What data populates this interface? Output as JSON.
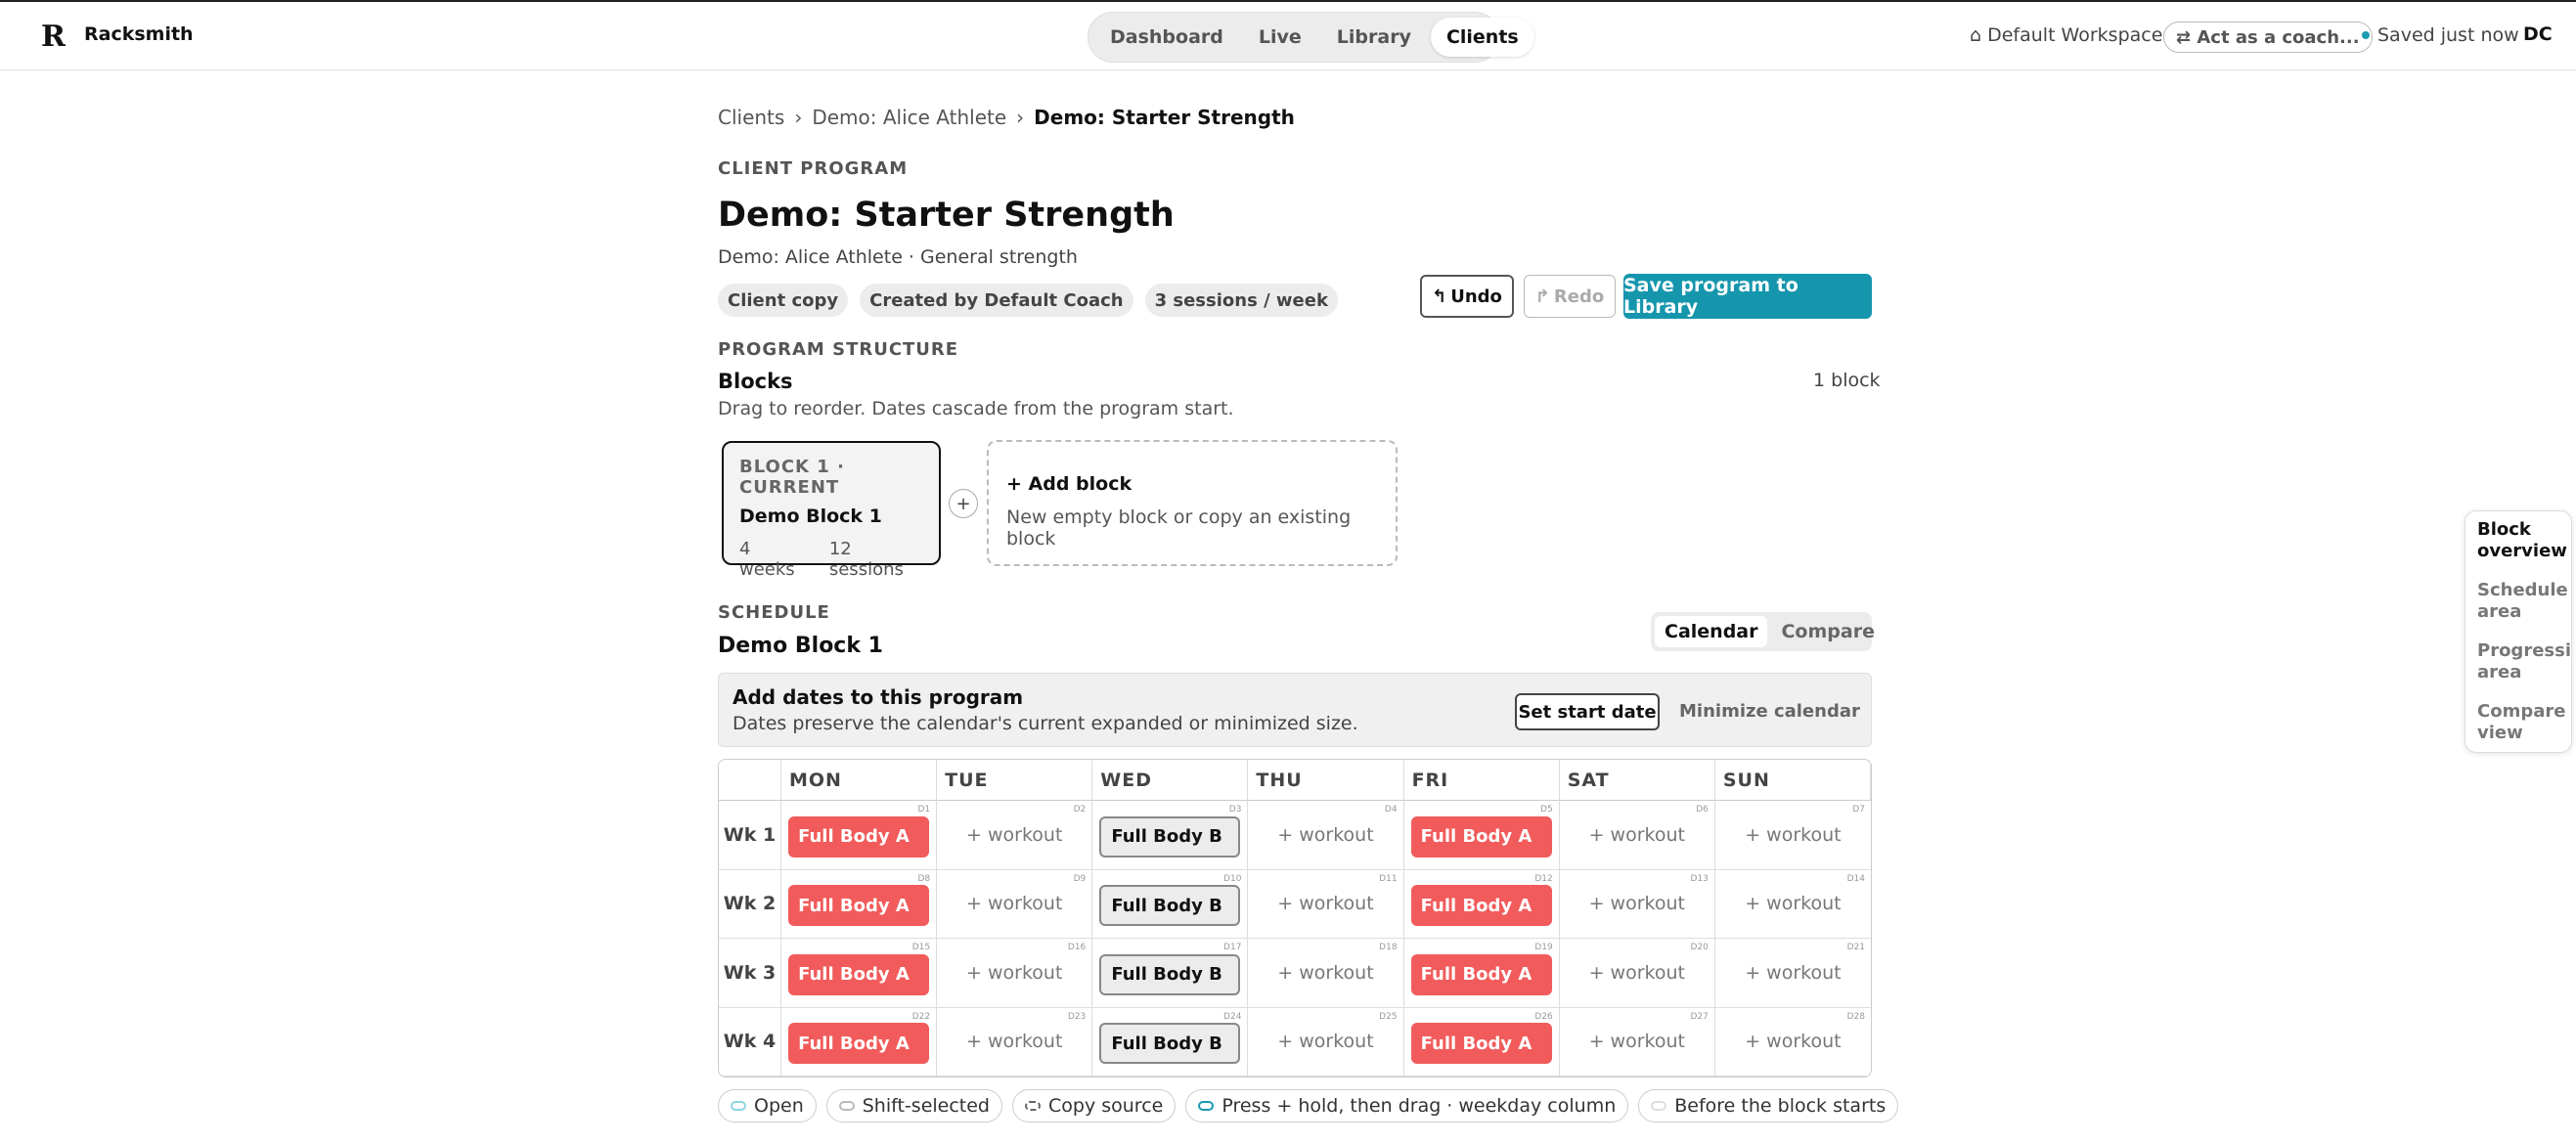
{
  "app": {
    "logo": "R",
    "name": "Racksmith"
  },
  "nav": {
    "tabs": [
      "Dashboard",
      "Live",
      "Library",
      "Clients"
    ],
    "active": "Clients"
  },
  "header_right": {
    "workspace": "⌂ Default Workspace",
    "act_as": "⇄ Act as a coach...",
    "saved": "Saved just now",
    "avatar": "DC"
  },
  "breadcrumb": {
    "items": [
      "Clients",
      "Demo: Alice Athlete",
      "Demo: Starter Strength"
    ],
    "separator": "›"
  },
  "program": {
    "eyebrow": "CLIENT PROGRAM",
    "title": "Demo: Starter Strength",
    "subtitle": "Demo: Alice Athlete · General strength",
    "tags": [
      "Client copy",
      "Created by Default Coach",
      "3 sessions / week"
    ],
    "undo": "Undo",
    "redo": "Redo",
    "save": "Save program to Library"
  },
  "structure": {
    "eyebrow": "PROGRAM STRUCTURE",
    "heading": "Blocks",
    "subheading": "Drag to reorder. Dates cascade from the program start.",
    "count": "1 block",
    "block": {
      "eyebrow": "BLOCK 1 · CURRENT",
      "name": "Demo Block 1",
      "weeks": "4 weeks",
      "sessions": "12 sessions"
    },
    "add": {
      "plus": "+",
      "title": "+ Add block",
      "sub": "New empty block or copy an existing block"
    }
  },
  "schedule": {
    "eyebrow": "SCHEDULE",
    "name": "Demo Block 1",
    "views": [
      "Calendar",
      "Compare"
    ],
    "banner": {
      "title": "Add dates to this program",
      "sub": "Dates preserve the calendar's current expanded or minimized size.",
      "set_start": "Set start date",
      "minimize": "Minimize calendar"
    },
    "days": [
      "MON",
      "TUE",
      "WED",
      "THU",
      "FRI",
      "SAT",
      "SUN"
    ],
    "weeks": [
      {
        "label": "Wk 1",
        "cells": [
          {
            "d": "D1",
            "w": "Full Body A",
            "c": "red"
          },
          {
            "d": "D2",
            "w": "+ workout"
          },
          {
            "d": "D3",
            "w": "Full Body B",
            "c": "grey"
          },
          {
            "d": "D4",
            "w": "+ workout"
          },
          {
            "d": "D5",
            "w": "Full Body A",
            "c": "red"
          },
          {
            "d": "D6",
            "w": "+ workout"
          },
          {
            "d": "D7",
            "w": "+ workout"
          }
        ]
      },
      {
        "label": "Wk 2",
        "cells": [
          {
            "d": "D8",
            "w": "Full Body A",
            "c": "red"
          },
          {
            "d": "D9",
            "w": "+ workout"
          },
          {
            "d": "D10",
            "w": "Full Body B",
            "c": "grey"
          },
          {
            "d": "D11",
            "w": "+ workout"
          },
          {
            "d": "D12",
            "w": "Full Body A",
            "c": "red"
          },
          {
            "d": "D13",
            "w": "+ workout"
          },
          {
            "d": "D14",
            "w": "+ workout"
          }
        ]
      },
      {
        "label": "Wk 3",
        "cells": [
          {
            "d": "D15",
            "w": "Full Body A",
            "c": "red"
          },
          {
            "d": "D16",
            "w": "+ workout"
          },
          {
            "d": "D17",
            "w": "Full Body B",
            "c": "grey"
          },
          {
            "d": "D18",
            "w": "+ workout"
          },
          {
            "d": "D19",
            "w": "Full Body A",
            "c": "red"
          },
          {
            "d": "D20",
            "w": "+ workout"
          },
          {
            "d": "D21",
            "w": "+ workout"
          }
        ]
      },
      {
        "label": "Wk 4",
        "cells": [
          {
            "d": "D22",
            "w": "Full Body A",
            "c": "red"
          },
          {
            "d": "D23",
            "w": "+ workout"
          },
          {
            "d": "D24",
            "w": "Full Body B",
            "c": "grey"
          },
          {
            "d": "D25",
            "w": "+ workout"
          },
          {
            "d": "D26",
            "w": "Full Body A",
            "c": "red"
          },
          {
            "d": "D27",
            "w": "+ workout"
          },
          {
            "d": "D28",
            "w": "+ workout"
          }
        ]
      }
    ],
    "legend": [
      {
        "label": "Open",
        "color": "#8fd3e0"
      },
      {
        "label": "Shift-selected",
        "color": "#bbbbbb"
      },
      {
        "label": "Copy source",
        "color": "#ffffff"
      },
      {
        "label": "Press + hold, then drag · weekday column",
        "color": "#1b9ab0"
      },
      {
        "label": "Before the block starts",
        "color": "#dddddd"
      }
    ]
  },
  "side_nav": [
    "Block overview",
    "Schedule area",
    "Progression area",
    "Compare view"
  ]
}
